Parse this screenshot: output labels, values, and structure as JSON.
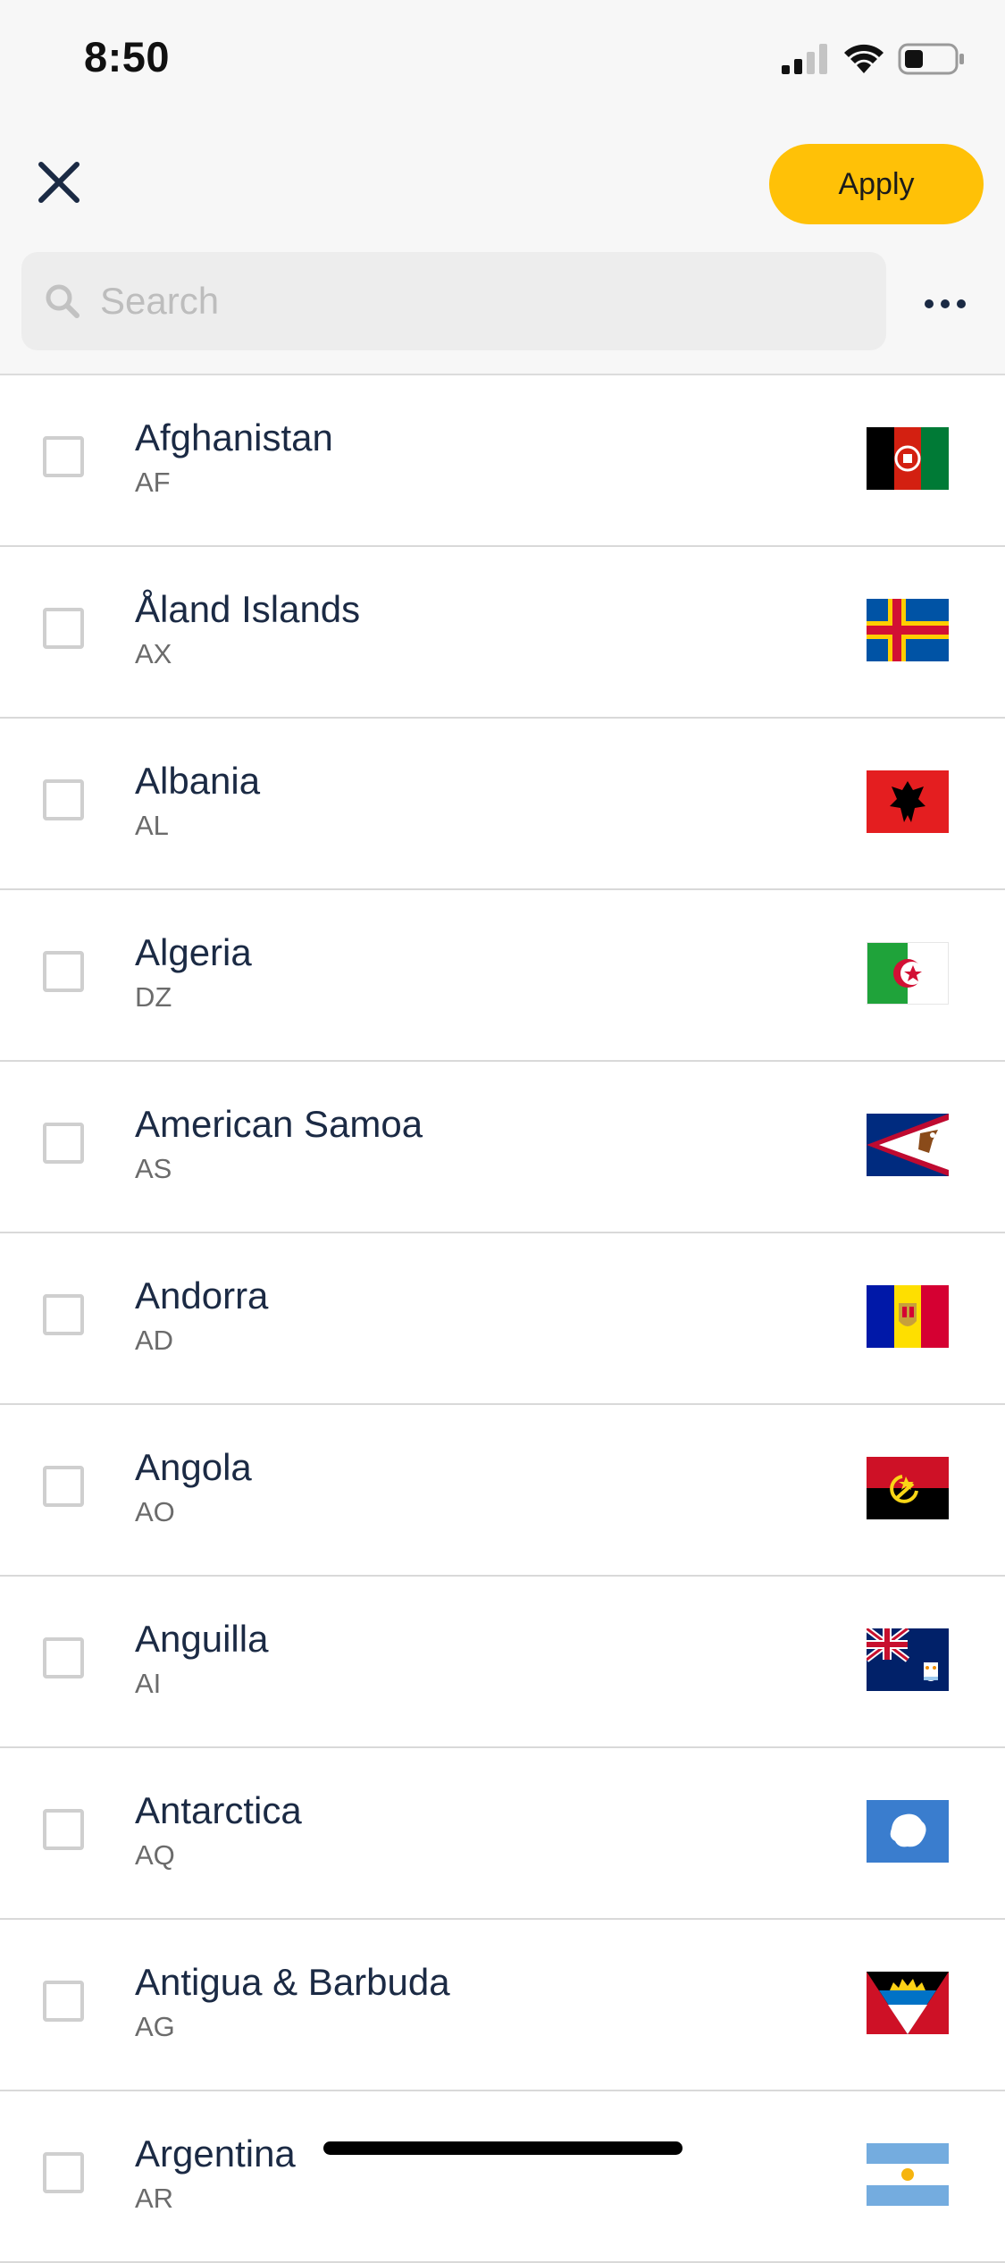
{
  "status_bar": {
    "time": "8:50"
  },
  "header": {
    "apply_label": "Apply"
  },
  "search": {
    "placeholder": "Search"
  },
  "countries": [
    {
      "name": "Afghanistan",
      "code": "AF"
    },
    {
      "name": "Åland Islands",
      "code": "AX"
    },
    {
      "name": "Albania",
      "code": "AL"
    },
    {
      "name": "Algeria",
      "code": "DZ"
    },
    {
      "name": "American Samoa",
      "code": "AS"
    },
    {
      "name": "Andorra",
      "code": "AD"
    },
    {
      "name": "Angola",
      "code": "AO"
    },
    {
      "name": "Anguilla",
      "code": "AI"
    },
    {
      "name": "Antarctica",
      "code": "AQ"
    },
    {
      "name": "Antigua & Barbuda",
      "code": "AG"
    },
    {
      "name": "Argentina",
      "code": "AR"
    }
  ],
  "colors": {
    "accent": "#ffc107",
    "text_primary": "#1b2a44",
    "text_secondary": "#6b6b6b",
    "header_bg": "#f7f7f7",
    "search_bg": "#ededed"
  },
  "icons": {
    "close": "close-icon",
    "search": "search-icon",
    "more": "more-horizontal-icon",
    "signal": "cellular-signal-icon",
    "wifi": "wifi-icon",
    "battery": "battery-icon"
  }
}
